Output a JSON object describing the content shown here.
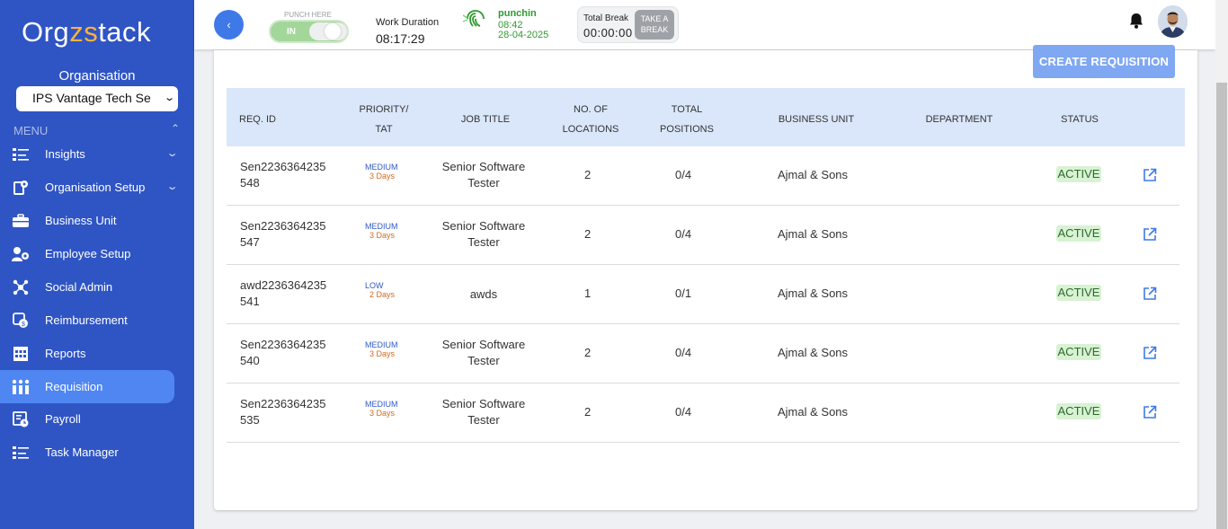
{
  "app": {
    "logo_left": "Org",
    "logo_mid": "zs",
    "logo_right": "tack"
  },
  "sidebar": {
    "org_label": "Organisation",
    "org_select_value": "IPS Vantage Tech Se",
    "menu_label": "MENU",
    "items": [
      {
        "label": "Insights",
        "icon": "insights-icon",
        "expandable": true
      },
      {
        "label": "Organisation Setup",
        "icon": "organisation-setup-icon",
        "expandable": true
      },
      {
        "label": "Business Unit",
        "icon": "briefcase-icon",
        "expandable": false
      },
      {
        "label": "Employee Setup",
        "icon": "users-icon",
        "expandable": false
      },
      {
        "label": "Social Admin",
        "icon": "social-admin-icon",
        "expandable": false
      },
      {
        "label": "Reimbursement",
        "icon": "reimbursement-icon",
        "expandable": false
      },
      {
        "label": "Reports",
        "icon": "reports-icon",
        "expandable": false
      },
      {
        "label": "Requisition",
        "icon": "requisition-icon",
        "expandable": false,
        "active": true
      },
      {
        "label": "Payroll",
        "icon": "payroll-icon",
        "expandable": false
      },
      {
        "label": "Task Manager",
        "icon": "task-manager-icon",
        "expandable": false
      }
    ]
  },
  "topbar": {
    "punch_label": "PUNCH HERE",
    "punch_state": "IN",
    "work_duration_label": "Work Duration",
    "work_duration_value": "08:17:29",
    "punchin_title": "punchin",
    "punchin_time": "08:42",
    "punchin_date": "28-04-2025",
    "total_break_label": "Total Break",
    "total_break_value": "00:00:00",
    "take_break_line1": "TAKE A",
    "take_break_line2": "BREAK"
  },
  "main": {
    "create_button": "CREATE REQUISITION",
    "columns": {
      "req_id": "REQ. ID",
      "priority_l1": "PRIORITY/",
      "priority_l2": "TAT",
      "job_title": "JOB TITLE",
      "locations_l1": "NO. OF",
      "locations_l2": "LOCATIONS",
      "positions_l1": "TOTAL",
      "positions_l2": "POSITIONS",
      "business_unit": "BUSINESS UNIT",
      "department": "DEPARTMENT",
      "status": "STATUS"
    },
    "rows": [
      {
        "id_l1": "Sen2236364235",
        "id_l2": "548",
        "priority": "MEDIUM",
        "tat": "3 Days",
        "title_l1": "Senior Software",
        "title_l2": "Tester",
        "locations": "2",
        "positions": "0/4",
        "unit": "Ajmal & Sons",
        "department": "",
        "status": "ACTIVE"
      },
      {
        "id_l1": "Sen2236364235",
        "id_l2": "547",
        "priority": "MEDIUM",
        "tat": "3 Days",
        "title_l1": "Senior Software",
        "title_l2": "Tester",
        "locations": "2",
        "positions": "0/4",
        "unit": "Ajmal & Sons",
        "department": "",
        "status": "ACTIVE"
      },
      {
        "id_l1": "awd2236364235",
        "id_l2": "541",
        "priority": "LOW",
        "tat": "2 Days",
        "title_l1": "awds",
        "title_l2": "",
        "locations": "1",
        "positions": "0/1",
        "unit": "Ajmal & Sons",
        "department": "",
        "status": "ACTIVE"
      },
      {
        "id_l1": "Sen2236364235",
        "id_l2": "540",
        "priority": "MEDIUM",
        "tat": "3 Days",
        "title_l1": "Senior Software",
        "title_l2": "Tester",
        "locations": "2",
        "positions": "0/4",
        "unit": "Ajmal & Sons",
        "department": "",
        "status": "ACTIVE"
      },
      {
        "id_l1": "Sen2236364235",
        "id_l2": "535",
        "priority": "MEDIUM",
        "tat": "3 Days",
        "title_l1": "Senior Software",
        "title_l2": "Tester",
        "locations": "2",
        "positions": "0/4",
        "unit": "Ajmal & Sons",
        "department": "",
        "status": "ACTIVE"
      }
    ]
  },
  "colors": {
    "sidebar_bg": "#2f55c4",
    "active_item": "#4f86f2",
    "table_header": "#dae7fb",
    "create_button": "#7fa7f2",
    "status_active_bg": "#d8f2d3",
    "punch_green": "#2e9a2e"
  }
}
